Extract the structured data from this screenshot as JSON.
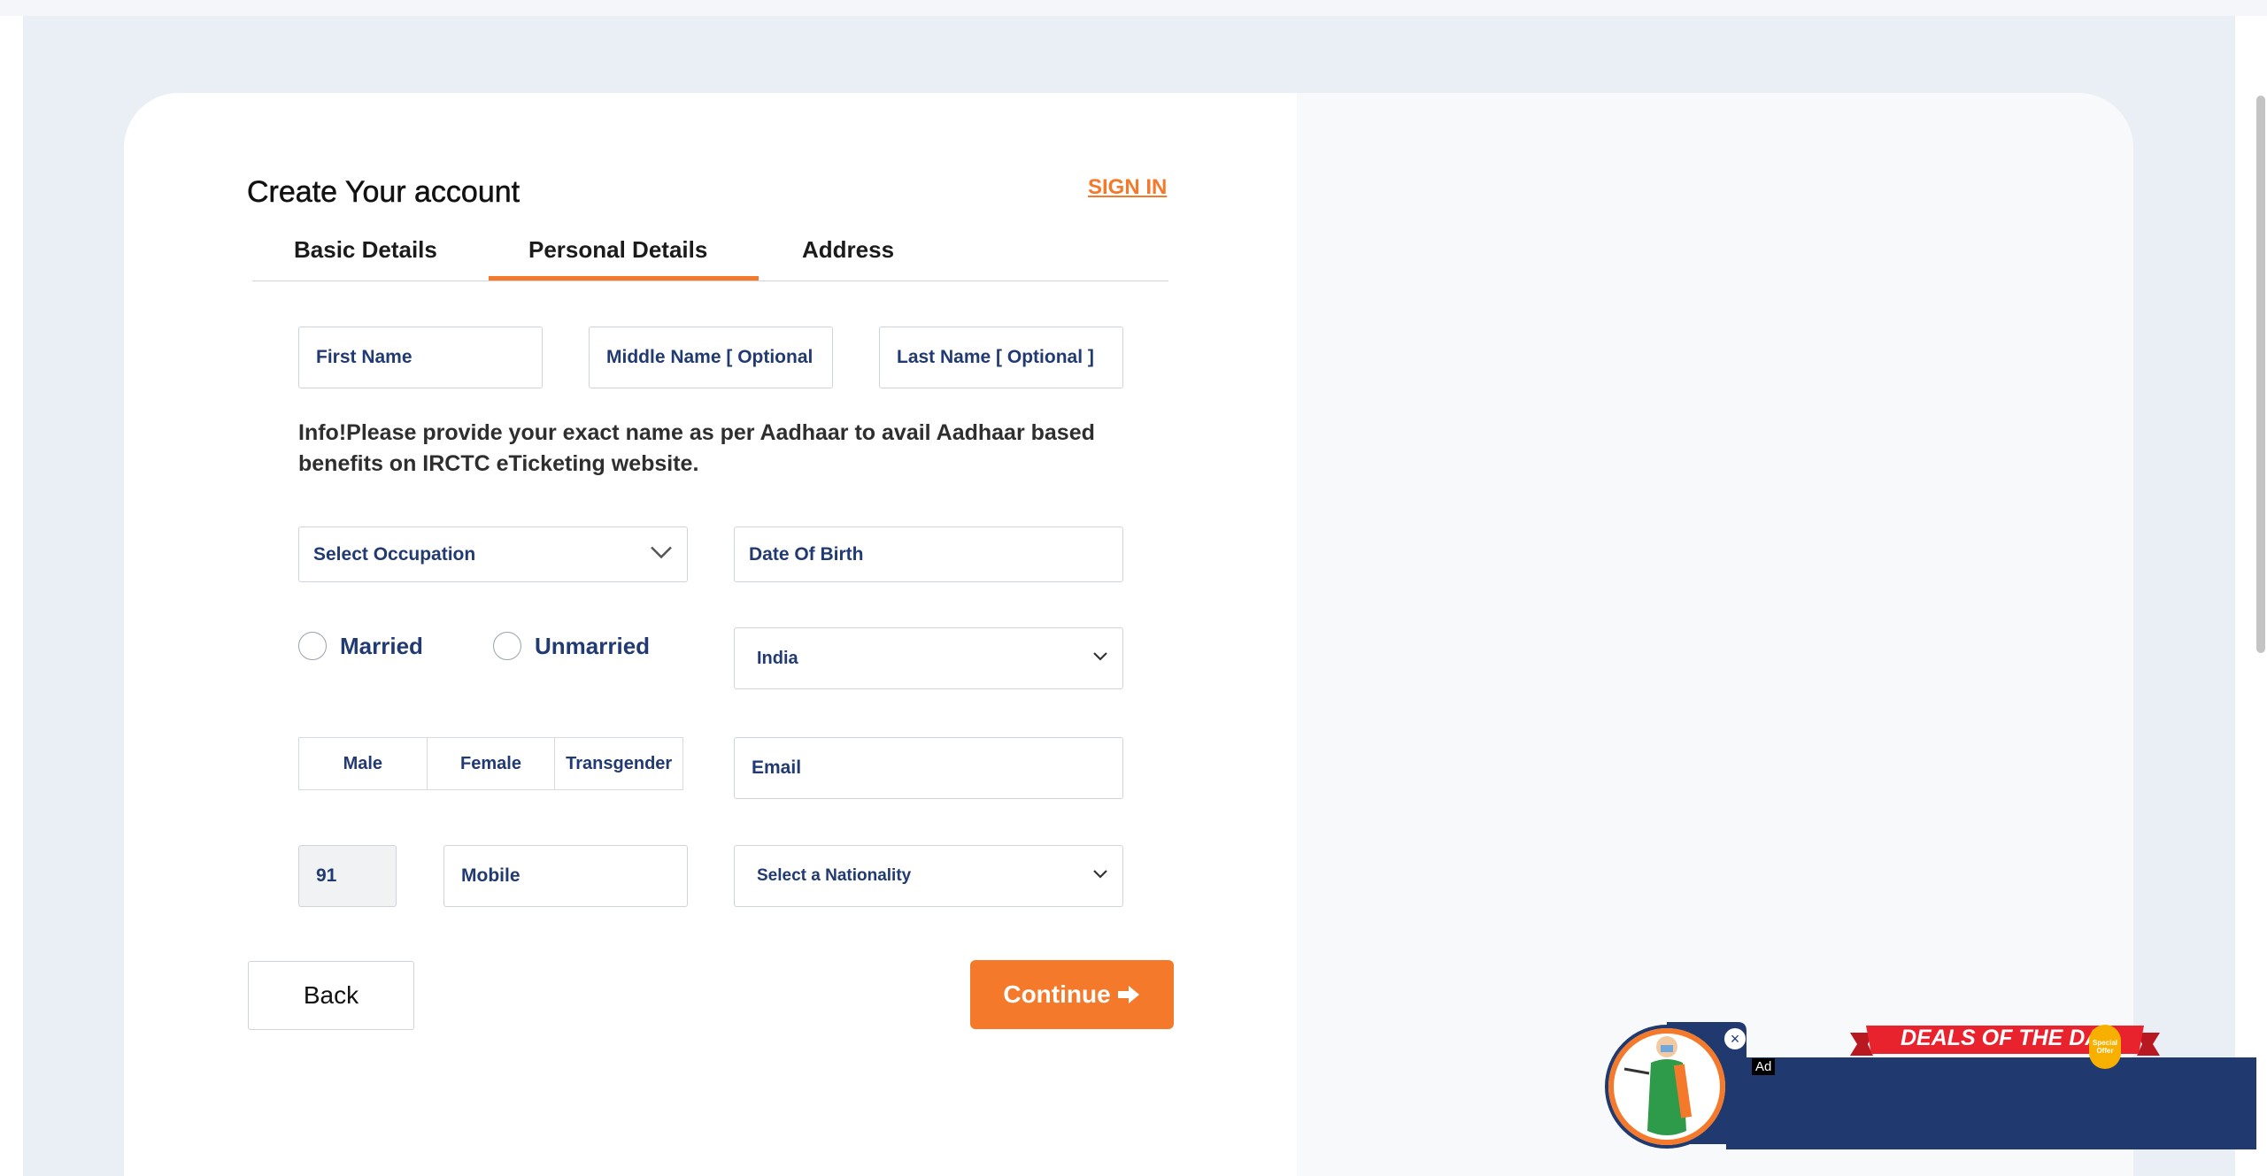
{
  "header": {
    "title": "Create Your account",
    "signin_label": "SIGN IN"
  },
  "tabs": [
    {
      "label": "Basic Details",
      "active": false
    },
    {
      "label": "Personal Details",
      "active": true
    },
    {
      "label": "Address",
      "active": false
    }
  ],
  "form": {
    "first_name_placeholder": "First Name",
    "middle_name_placeholder": "Middle Name  [ Optional",
    "last_name_placeholder": "Last Name  [ Optional ]",
    "info_text": "Info!Please provide your exact name as per Aadhaar to avail Aadhaar based benefits on IRCTC eTicketing website.",
    "occupation_selected": "Select Occupation",
    "dob_placeholder": "Date Of Birth",
    "marital": {
      "married": "Married",
      "unmarried": "Unmarried"
    },
    "country_selected": "India",
    "gender": {
      "male": "Male",
      "female": "Female",
      "transgender": "Transgender"
    },
    "email_placeholder": "Email",
    "isd_code": "91",
    "mobile_placeholder": "Mobile",
    "nationality_selected": "Select a Nationality"
  },
  "actions": {
    "back_label": "Back",
    "continue_label": "Continue"
  },
  "ad": {
    "label": "Ad",
    "headline": "DEALS OF THE DAY",
    "badge": "Special Offer",
    "close_glyph": "×"
  },
  "colors": {
    "accent": "#f5792a",
    "label_navy": "#213a71",
    "ad_navy": "#203a6f",
    "ribbon_red": "#e8232e"
  }
}
